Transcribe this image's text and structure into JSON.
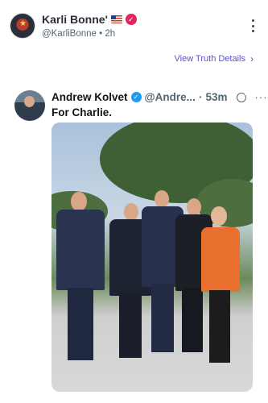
{
  "post": {
    "display_name": "Karli Bonne'",
    "handle": "@KarliBonne",
    "separator": "•",
    "age": "2h",
    "view_details": "View Truth Details"
  },
  "quoted": {
    "name": "Andrew Kolvet",
    "handle": "@Andre...",
    "separator": "·",
    "time": "53m",
    "text": "For Charlie."
  },
  "colors": {
    "link": "#5b55c9",
    "verified_pink": "#e0245e",
    "verified_blue": "#1d9bf0"
  }
}
